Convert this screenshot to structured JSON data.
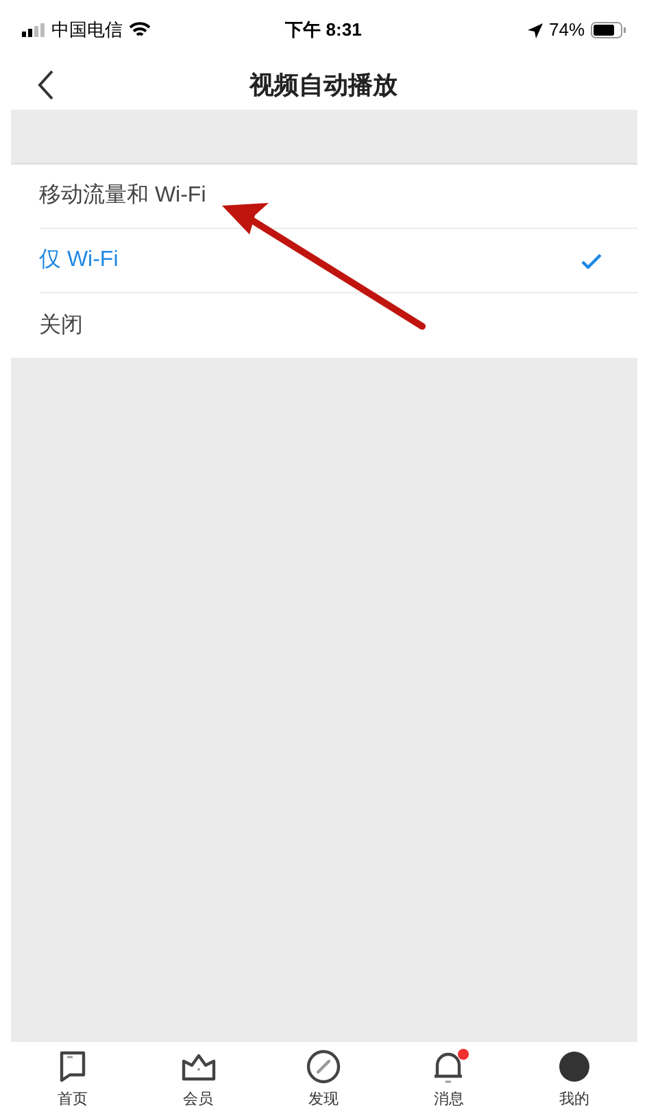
{
  "status_bar": {
    "carrier": "中国电信",
    "time": "下午 8:31",
    "battery": "74%"
  },
  "nav": {
    "title": "视频自动播放"
  },
  "options": [
    {
      "label": "移动流量和 Wi-Fi",
      "selected": false
    },
    {
      "label": "仅 Wi-Fi",
      "selected": true
    },
    {
      "label": "关闭",
      "selected": false
    }
  ],
  "tab_bar": [
    {
      "label": "首页",
      "kind": "home",
      "dot": false
    },
    {
      "label": "会员",
      "kind": "vip",
      "dot": false
    },
    {
      "label": "发现",
      "kind": "discover",
      "dot": false
    },
    {
      "label": "消息",
      "kind": "messages",
      "dot": true
    },
    {
      "label": "我的",
      "kind": "me",
      "dot": false
    }
  ]
}
